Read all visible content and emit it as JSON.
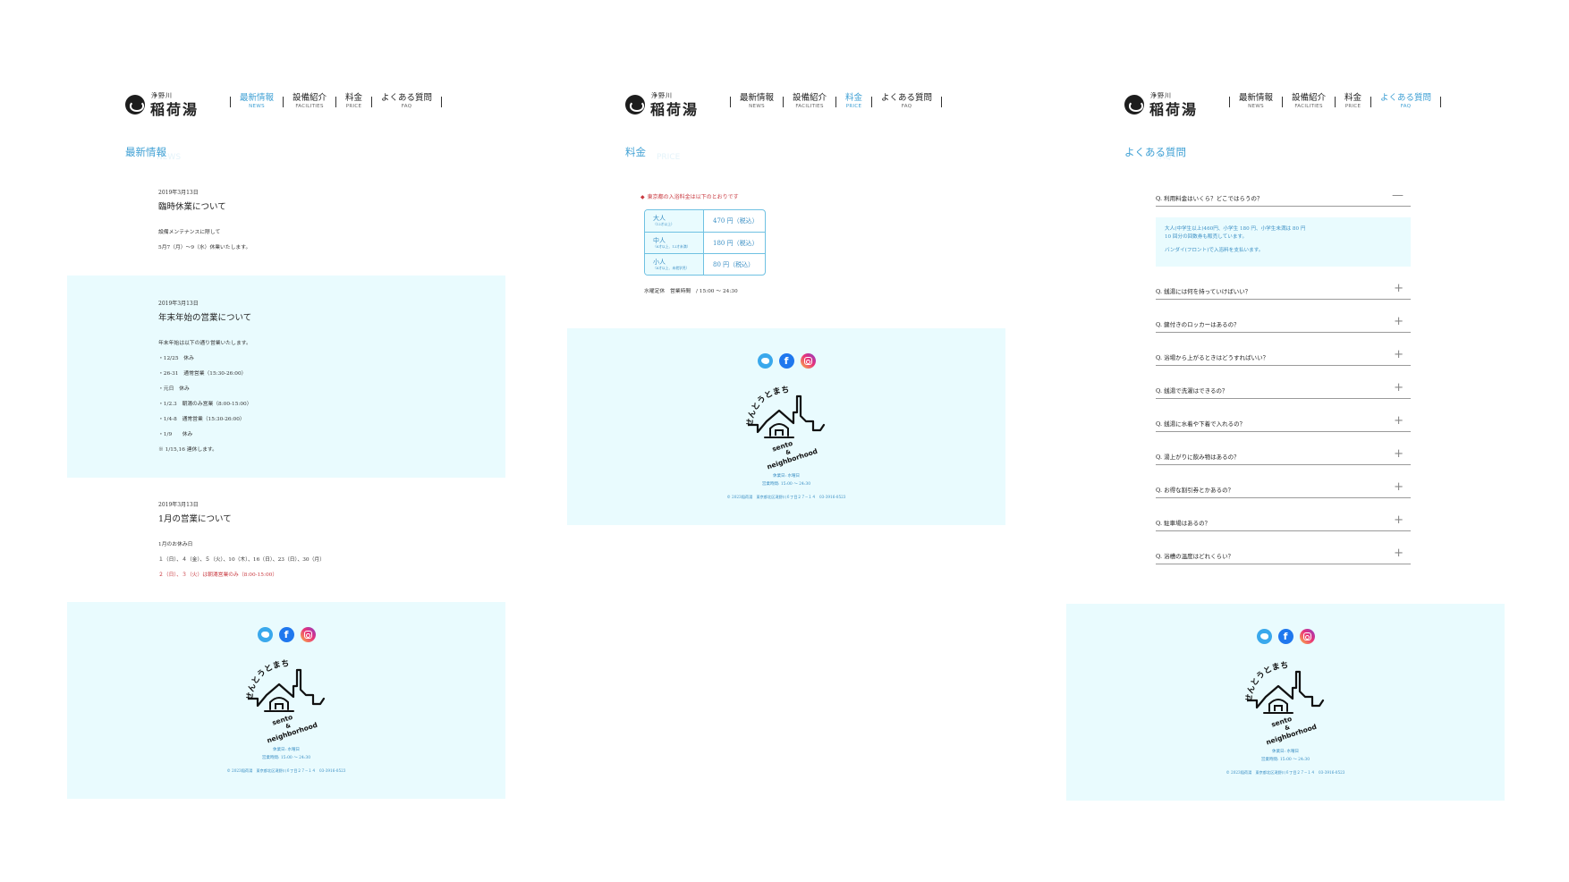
{
  "brand": {
    "small": "浄野川",
    "big": "稲荷湯"
  },
  "nav": [
    {
      "jp": "最新情報",
      "en": "NEWS"
    },
    {
      "jp": "設備紹介",
      "en": "FACILITIES"
    },
    {
      "jp": "料金",
      "en": "PRICE"
    },
    {
      "jp": "よくある質問",
      "en": "FAQ"
    }
  ],
  "news_page": {
    "title": "最新情報",
    "title_ghost": "NEWS",
    "posts": [
      {
        "date": "2019年3月13日",
        "title": "臨時休業について",
        "lines": [
          "設備メンテナンスに際して",
          "5月7（月）～9（水）休業いたします。"
        ]
      },
      {
        "date": "2019年3月13日",
        "title": "年末年始の営業について",
        "lines": [
          "年末年始は以下の通り営業いたします。",
          "・12/25　休み",
          "・26-31　通常営業（15:30-26:00）",
          "・元日　休み",
          "・1/2.3　朝湯のみ営業（8:00-15:00）",
          "・1/4-8　通常営業（15:30-26:00）",
          "・1/9　　休み",
          "※ 1/15,16 連休します。"
        ]
      },
      {
        "date": "2019年3月13日",
        "title": "1月の営業について",
        "lines": [
          "1月のお休み日",
          "１（日）、４（金）、５（火）、10（木）、16（日）、23（日）、30（月）"
        ],
        "red_line": "２（日）、３（火）は朝湯営業のみ（8:00-15:00）"
      }
    ]
  },
  "price_page": {
    "title": "料金",
    "title_ghost": "PRICE",
    "note": "東京都の入浴料金は以下のとおりです",
    "rows": [
      {
        "label": "大人",
        "sub": "（12才以上）",
        "value": "470 円（税込）"
      },
      {
        "label": "中人",
        "sub": "（6才以上、12才未満）",
        "value": "180 円（税込）"
      },
      {
        "label": "小人",
        "sub": "（6才以上、未就学児）",
        "value": "80 円（税込）"
      }
    ],
    "hours": "水曜定休　営業時間　/ 15:00 ～ 24:30"
  },
  "faq_page": {
    "title": "よくある質問",
    "title_ghost": "FAQ",
    "open": {
      "q": "Q. 利用料金はいくら？どこではらうの？",
      "toggle": "—"
    },
    "answer": [
      "大人(中学生以上)460円、小学生 180 円、小学生未満は 80 円",
      "10 回分の回数券も販売しています。",
      "バンダイ(フロント)で入浴料を支払います。"
    ],
    "questions": [
      "Q. 銭湯には何を持っていけばいい？",
      "Q. 鍵付きのロッカーはあるの？",
      "Q. 浴場から上がるときはどうすればいい？",
      "Q. 銭湯で洗濯はできるの？",
      "Q. 銭湯に水着や下着で入れるの？",
      "Q. 湯上がりに飲み物はあるの？",
      "Q. お得な割引券とかあるの？",
      "Q. 駐車場はあるの？",
      "Q. 浴槽の温度はどれくらい？"
    ],
    "plus": "+"
  },
  "footer": {
    "social": [
      "twitter-icon",
      "facebook-icon",
      "instagram-icon"
    ],
    "fb_glyph": "f",
    "logo_arc_text": "せんとうとまち",
    "logo_lines": [
      "sento",
      "&",
      "neighborhood"
    ],
    "info_1": "休業日: 水曜日",
    "info_2": "営業時間: 15:00 ～ 24:30",
    "copy": "© 2023稲荷湯　東京都北区滝野川６丁目２７−１４　03-3916-0523"
  },
  "colors": {
    "accent": "#3fa0d4",
    "tint": "#e9fbfe",
    "red": "#c8383f"
  }
}
